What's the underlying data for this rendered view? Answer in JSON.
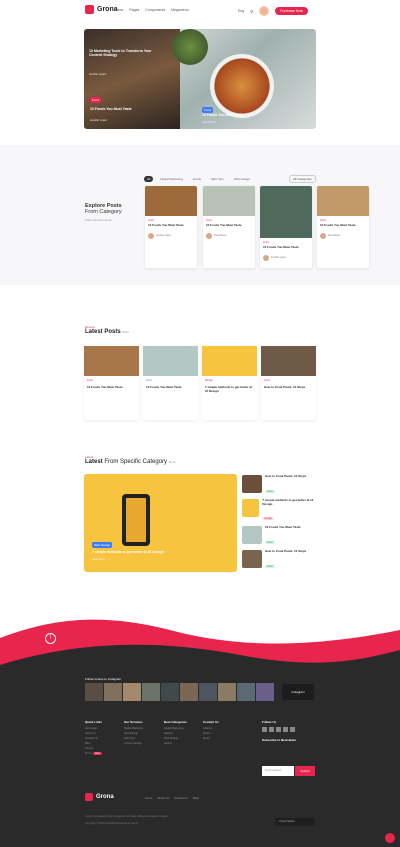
{
  "header": {
    "logo": "Grona",
    "nav": [
      "Home",
      "Pages",
      "Components",
      "Megamenu"
    ],
    "lang": "Eng",
    "cta": "Purchase Now"
  },
  "hero": {
    "left_title": "10 Marketing Tools to Transform Your Content Strategy",
    "left_tag": "Food",
    "left_author": "Jennifer Lopez",
    "bottom_left_tag": "Food",
    "bottom_left_title": "10 Foods You Must Taste",
    "bottom_left_author": "Jennifer Lopez",
    "right_tag": "Food",
    "right_title": "10 Foods You Must Taste",
    "right_author": "Jose Rivera"
  },
  "explore": {
    "title_top": "Explore Posts",
    "title_bottom": "From Category",
    "desc": "Follow the latest trends",
    "filters": [
      "All",
      "Digital Marketing",
      "Foods",
      "SEO Tips",
      "Web Design"
    ],
    "all_label": "All Categories",
    "cards": [
      {
        "cat": "Food",
        "title": "10 Foods You Must Taste",
        "author": "Jennifer Lopez"
      },
      {
        "cat": "Food",
        "title": "10 Foods You Must Taste",
        "author": "Jose Rivera"
      },
      {
        "cat": "Food",
        "title": "10 Foods You Must Taste",
        "author": "Jennifer Lopez"
      },
      {
        "cat": "Food",
        "title": "10 Foods You Must Taste",
        "author": "Jose Rivera"
      }
    ]
  },
  "latest": {
    "kicker": "Recent",
    "title": "Latest Posts",
    "more": "More",
    "cards": [
      {
        "cat": "Food",
        "title": "10 Foods You Must Taste"
      },
      {
        "cat": "Food",
        "title": "10 Foods You Must Taste"
      },
      {
        "cat": "Design",
        "title": "7 simple methods to get better at UI Design"
      },
      {
        "cat": "Food",
        "title": "How to Cook Pasta: 10 Steps"
      }
    ]
  },
  "specific": {
    "kicker": "Latest",
    "title_bold": "Latest",
    "title_rest": "From Specific Category",
    "more": "More",
    "feature_tag": "Web Design",
    "feature_title": "7 simple methods to get better at UI Design",
    "feature_more": "Read More",
    "list": [
      {
        "title": "How to Cook Pasta: 10 Steps",
        "badge": "Food"
      },
      {
        "title": "7 simple methods to get better at UI Design",
        "badge": "Design"
      },
      {
        "title": "10 Foods You Must Taste",
        "badge": "Food"
      },
      {
        "title": "How to Cook Pasta: 10 Steps",
        "badge": "Food"
      }
    ]
  },
  "footer": {
    "follow_insta": "Follow Grona on Instagram",
    "insta_label": "Instagram",
    "cols": [
      {
        "title": "Quick Links",
        "items": [
          "Homepage",
          "About Us",
          "Contact Us",
          "Blog",
          "Privacy",
          "Terms"
        ]
      },
      {
        "title": "Our Services",
        "items": [
          "Digital Marketing",
          "Web Design",
          "SEO Tips",
          "Content Design"
        ]
      },
      {
        "title": "Best Categories",
        "items": [
          "Digital Marketing",
          "Fashion",
          "Web Design",
          "Design"
        ]
      },
      {
        "title": "Contact Us",
        "items": [
          "Address",
          "Phone",
          "Email"
        ]
      },
      {
        "title": "Follow Us",
        "items": []
      }
    ],
    "badge": "New",
    "subscribe_title": "Subscribe to Newsletter",
    "subscribe_placeholder": "Email Address",
    "subscribe_btn": "Submit",
    "logo": "Grona",
    "links": [
      "Home",
      "About Us",
      "Contact Us",
      "Blog"
    ],
    "desc": "Grona is a beautiful blog & magazine template crafted for creative bloggers.",
    "copyright": "Copyright © 2019 All Rights Reserved by Grona",
    "lang": "United States"
  },
  "colors": {
    "accent": "#e8254d",
    "dark": "#2a2a2a"
  }
}
